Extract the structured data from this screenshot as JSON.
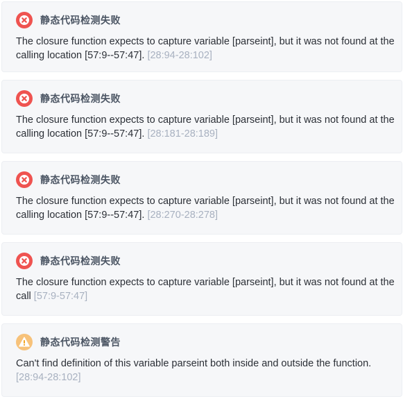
{
  "messages": [
    {
      "type": "error",
      "icon": "error-x-icon",
      "title": "静态代码检测失败",
      "text": "The closure function expects to capture variable [parseint], but it was not found at the calling location [57:9--57:47].",
      "location": "[28:94-28:102]"
    },
    {
      "type": "error",
      "icon": "error-x-icon",
      "title": "静态代码检测失败",
      "text": "The closure function expects to capture variable [parseint], but it was not found at the calling location [57:9--57:47].",
      "location": "[28:181-28:189]"
    },
    {
      "type": "error",
      "icon": "error-x-icon",
      "title": "静态代码检测失败",
      "text": "The closure function expects to capture variable [parseint], but it was not found at the calling location [57:9--57:47].",
      "location": "[28:270-28:278]"
    },
    {
      "type": "error",
      "icon": "error-x-icon",
      "title": "静态代码检测失败",
      "text": "The closure function expects to capture variable [parseint], but it was not found at the call",
      "location": "[57:9-57:47]"
    },
    {
      "type": "warning",
      "icon": "warning-exclamation-icon",
      "title": "静态代码检测警告",
      "text": "Can't find definition of this variable parseint both inside and outside the function.",
      "location": "[28:94-28:102]"
    }
  ],
  "colors": {
    "error": "#ef5350",
    "warning": "#f5b25b",
    "location": "#a8b1c0"
  }
}
